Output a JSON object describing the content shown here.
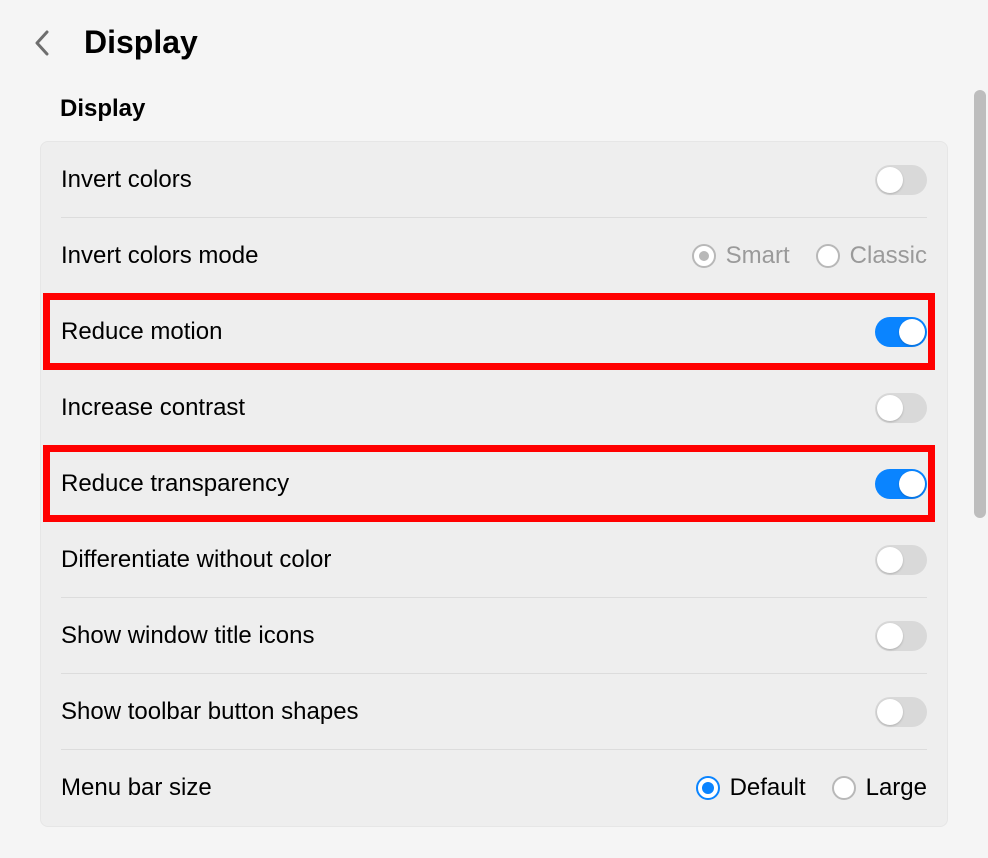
{
  "header": {
    "title": "Display"
  },
  "section": {
    "title": "Display"
  },
  "rows": {
    "invert_colors": {
      "label": "Invert colors",
      "toggle": false
    },
    "invert_colors_mode": {
      "label": "Invert colors mode",
      "options": {
        "smart": "Smart",
        "classic": "Classic"
      },
      "selected": "smart",
      "disabled": true
    },
    "reduce_motion": {
      "label": "Reduce motion",
      "toggle": true,
      "highlighted": true
    },
    "increase_contrast": {
      "label": "Increase contrast",
      "toggle": false
    },
    "reduce_transparency": {
      "label": "Reduce transparency",
      "toggle": true,
      "highlighted": true
    },
    "differentiate_without_color": {
      "label": "Differentiate without color",
      "toggle": false
    },
    "show_window_title_icons": {
      "label": "Show window title icons",
      "toggle": false
    },
    "show_toolbar_button_shapes": {
      "label": "Show toolbar button shapes",
      "toggle": false
    },
    "menu_bar_size": {
      "label": "Menu bar size",
      "options": {
        "default": "Default",
        "large": "Large"
      },
      "selected": "default",
      "disabled": false
    }
  }
}
